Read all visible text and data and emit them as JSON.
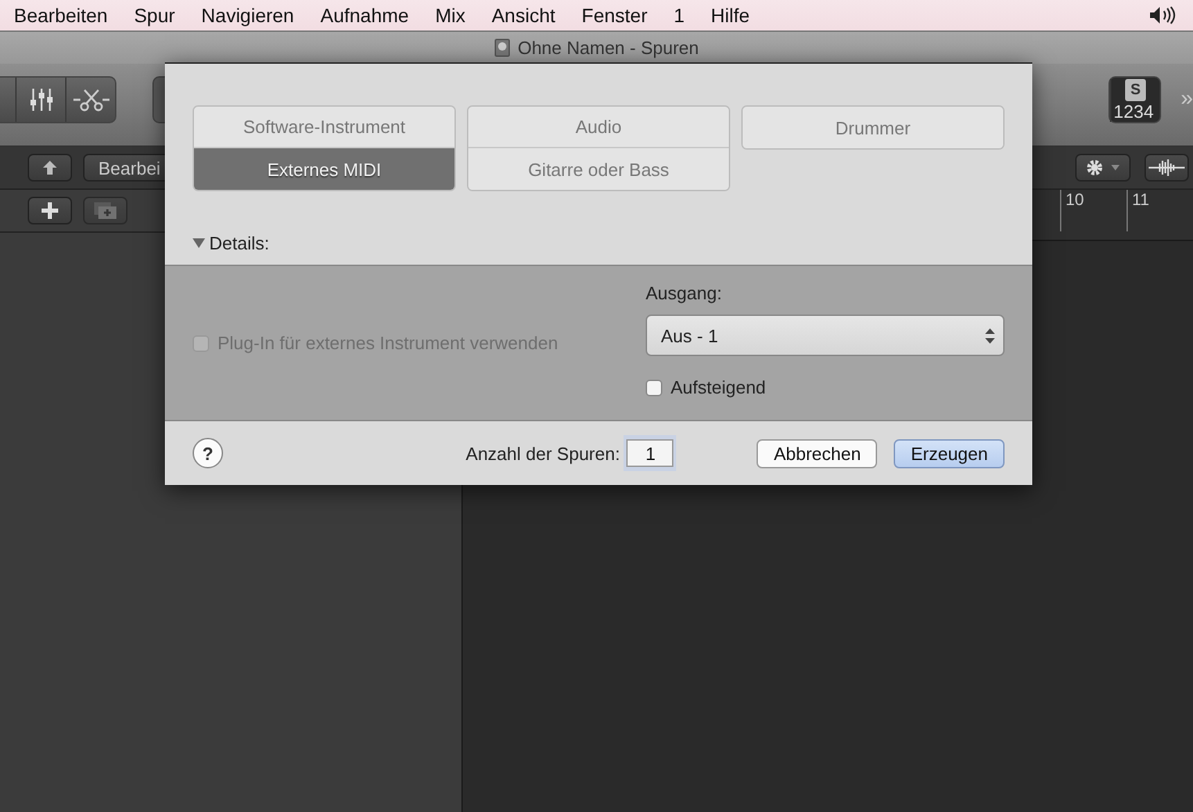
{
  "menu_bar": {
    "items": [
      "Bearbeiten",
      "Spur",
      "Navigieren",
      "Aufnahme",
      "Mix",
      "Ansicht",
      "Fenster",
      "1",
      "Hilfe"
    ]
  },
  "window": {
    "title": "Ohne Namen - Spuren"
  },
  "toolbar": {
    "solo_label": "S",
    "count_display": "1234",
    "overflow": "»"
  },
  "tracks_header": {
    "edit_button": "Bearbei"
  },
  "ruler": {
    "bars": [
      "10",
      "11"
    ]
  },
  "dialog": {
    "track_types": [
      [
        {
          "label": "Software-Instrument",
          "selected": false
        },
        {
          "label": "Externes MIDI",
          "selected": true
        }
      ],
      [
        {
          "label": "Audio",
          "selected": false
        },
        {
          "label": "Gitarre oder Bass",
          "selected": false
        }
      ],
      [
        {
          "label": "Drummer",
          "selected": false
        }
      ]
    ],
    "details": {
      "label": "Details:",
      "expanded": true
    },
    "plugin_option": {
      "label": "Plug-In für externes Instrument verwenden",
      "checked": false,
      "disabled": true
    },
    "output": {
      "label": "Ausgang:",
      "value": "Aus - 1"
    },
    "ascending": {
      "label": "Aufsteigend",
      "checked": false
    },
    "help_button": "?",
    "track_count": {
      "label": "Anzahl der Spuren:",
      "value": "1"
    },
    "buttons": [
      {
        "label": "Abbrechen",
        "default": false
      },
      {
        "label": "Erzeugen",
        "default": true
      }
    ]
  }
}
